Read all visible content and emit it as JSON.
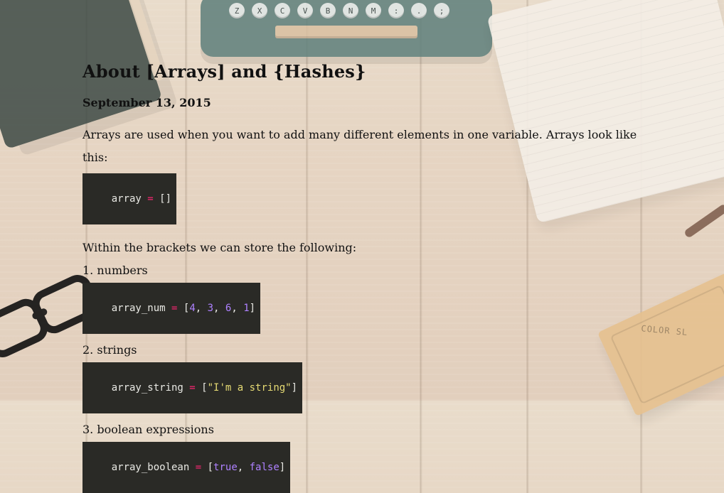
{
  "article": {
    "title": "About [Arrays] and {Hashes}",
    "date": "September 13, 2015",
    "intro_line_1": "Arrays are used when you want to add many different elements in one variable. Arrays look like",
    "intro_line_2": "this:",
    "code_empty_array": {
      "left": "array",
      "op": " = ",
      "right": "[]"
    },
    "within_brackets": "Within the brackets we can store the following:",
    "items": [
      {
        "label": "1. numbers",
        "code": {
          "left": "array_num",
          "op": " = ",
          "open": "[",
          "values": [
            "4",
            "3",
            "6",
            "1"
          ],
          "sep": ", ",
          "close": "]"
        }
      },
      {
        "label": "2. strings",
        "code": {
          "left": "array_string",
          "op": " = ",
          "open": "[",
          "value": "\"I'm a string\"",
          "close": "]"
        }
      },
      {
        "label": "3. boolean expressions",
        "code": {
          "left": "array_boolean",
          "op": " = ",
          "open": "[",
          "values": [
            "true",
            "false"
          ],
          "sep": ", ",
          "close": "]"
        }
      }
    ]
  },
  "decor": {
    "typewriter_keys": [
      "Z",
      "X",
      "C",
      "V",
      "B",
      "N",
      "M",
      ":",
      ".",
      ";"
    ],
    "box_label": "COLOR SL"
  }
}
